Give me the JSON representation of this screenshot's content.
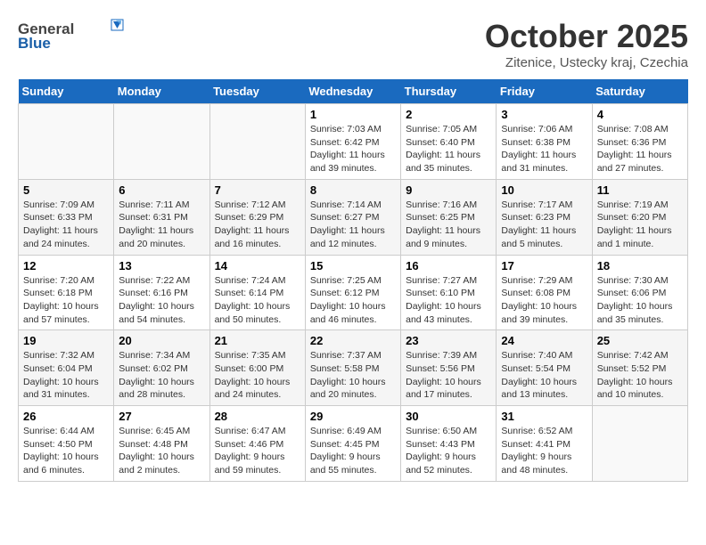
{
  "logo": {
    "general": "General",
    "blue": "Blue"
  },
  "title": "October 2025",
  "subtitle": "Zitenice, Ustecky kraj, Czechia",
  "days_header": [
    "Sunday",
    "Monday",
    "Tuesday",
    "Wednesday",
    "Thursday",
    "Friday",
    "Saturday"
  ],
  "weeks": [
    [
      {
        "num": "",
        "info": ""
      },
      {
        "num": "",
        "info": ""
      },
      {
        "num": "",
        "info": ""
      },
      {
        "num": "1",
        "info": "Sunrise: 7:03 AM\nSunset: 6:42 PM\nDaylight: 11 hours\nand 39 minutes."
      },
      {
        "num": "2",
        "info": "Sunrise: 7:05 AM\nSunset: 6:40 PM\nDaylight: 11 hours\nand 35 minutes."
      },
      {
        "num": "3",
        "info": "Sunrise: 7:06 AM\nSunset: 6:38 PM\nDaylight: 11 hours\nand 31 minutes."
      },
      {
        "num": "4",
        "info": "Sunrise: 7:08 AM\nSunset: 6:36 PM\nDaylight: 11 hours\nand 27 minutes."
      }
    ],
    [
      {
        "num": "5",
        "info": "Sunrise: 7:09 AM\nSunset: 6:33 PM\nDaylight: 11 hours\nand 24 minutes."
      },
      {
        "num": "6",
        "info": "Sunrise: 7:11 AM\nSunset: 6:31 PM\nDaylight: 11 hours\nand 20 minutes."
      },
      {
        "num": "7",
        "info": "Sunrise: 7:12 AM\nSunset: 6:29 PM\nDaylight: 11 hours\nand 16 minutes."
      },
      {
        "num": "8",
        "info": "Sunrise: 7:14 AM\nSunset: 6:27 PM\nDaylight: 11 hours\nand 12 minutes."
      },
      {
        "num": "9",
        "info": "Sunrise: 7:16 AM\nSunset: 6:25 PM\nDaylight: 11 hours\nand 9 minutes."
      },
      {
        "num": "10",
        "info": "Sunrise: 7:17 AM\nSunset: 6:23 PM\nDaylight: 11 hours\nand 5 minutes."
      },
      {
        "num": "11",
        "info": "Sunrise: 7:19 AM\nSunset: 6:20 PM\nDaylight: 11 hours\nand 1 minute."
      }
    ],
    [
      {
        "num": "12",
        "info": "Sunrise: 7:20 AM\nSunset: 6:18 PM\nDaylight: 10 hours\nand 57 minutes."
      },
      {
        "num": "13",
        "info": "Sunrise: 7:22 AM\nSunset: 6:16 PM\nDaylight: 10 hours\nand 54 minutes."
      },
      {
        "num": "14",
        "info": "Sunrise: 7:24 AM\nSunset: 6:14 PM\nDaylight: 10 hours\nand 50 minutes."
      },
      {
        "num": "15",
        "info": "Sunrise: 7:25 AM\nSunset: 6:12 PM\nDaylight: 10 hours\nand 46 minutes."
      },
      {
        "num": "16",
        "info": "Sunrise: 7:27 AM\nSunset: 6:10 PM\nDaylight: 10 hours\nand 43 minutes."
      },
      {
        "num": "17",
        "info": "Sunrise: 7:29 AM\nSunset: 6:08 PM\nDaylight: 10 hours\nand 39 minutes."
      },
      {
        "num": "18",
        "info": "Sunrise: 7:30 AM\nSunset: 6:06 PM\nDaylight: 10 hours\nand 35 minutes."
      }
    ],
    [
      {
        "num": "19",
        "info": "Sunrise: 7:32 AM\nSunset: 6:04 PM\nDaylight: 10 hours\nand 31 minutes."
      },
      {
        "num": "20",
        "info": "Sunrise: 7:34 AM\nSunset: 6:02 PM\nDaylight: 10 hours\nand 28 minutes."
      },
      {
        "num": "21",
        "info": "Sunrise: 7:35 AM\nSunset: 6:00 PM\nDaylight: 10 hours\nand 24 minutes."
      },
      {
        "num": "22",
        "info": "Sunrise: 7:37 AM\nSunset: 5:58 PM\nDaylight: 10 hours\nand 20 minutes."
      },
      {
        "num": "23",
        "info": "Sunrise: 7:39 AM\nSunset: 5:56 PM\nDaylight: 10 hours\nand 17 minutes."
      },
      {
        "num": "24",
        "info": "Sunrise: 7:40 AM\nSunset: 5:54 PM\nDaylight: 10 hours\nand 13 minutes."
      },
      {
        "num": "25",
        "info": "Sunrise: 7:42 AM\nSunset: 5:52 PM\nDaylight: 10 hours\nand 10 minutes."
      }
    ],
    [
      {
        "num": "26",
        "info": "Sunrise: 6:44 AM\nSunset: 4:50 PM\nDaylight: 10 hours\nand 6 minutes."
      },
      {
        "num": "27",
        "info": "Sunrise: 6:45 AM\nSunset: 4:48 PM\nDaylight: 10 hours\nand 2 minutes."
      },
      {
        "num": "28",
        "info": "Sunrise: 6:47 AM\nSunset: 4:46 PM\nDaylight: 9 hours\nand 59 minutes."
      },
      {
        "num": "29",
        "info": "Sunrise: 6:49 AM\nSunset: 4:45 PM\nDaylight: 9 hours\nand 55 minutes."
      },
      {
        "num": "30",
        "info": "Sunrise: 6:50 AM\nSunset: 4:43 PM\nDaylight: 9 hours\nand 52 minutes."
      },
      {
        "num": "31",
        "info": "Sunrise: 6:52 AM\nSunset: 4:41 PM\nDaylight: 9 hours\nand 48 minutes."
      },
      {
        "num": "",
        "info": ""
      }
    ]
  ]
}
